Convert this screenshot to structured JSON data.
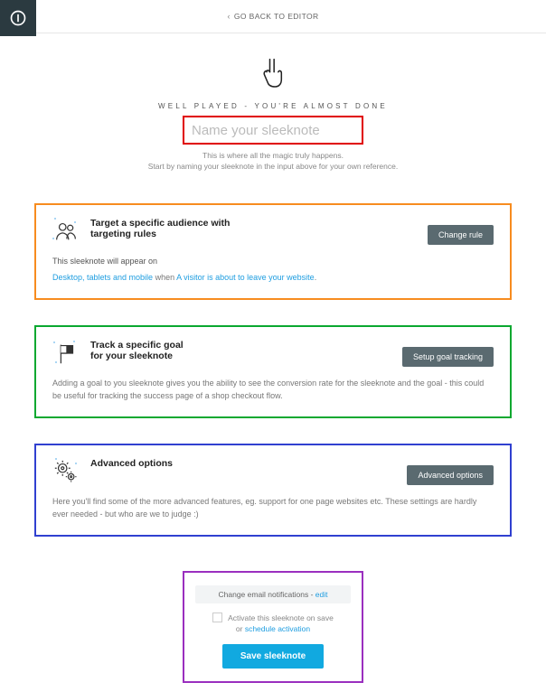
{
  "topbar": {
    "back_label": "GO BACK TO EDITOR"
  },
  "hero": {
    "title": "WELL PLAYED - YOU'RE ALMOST DONE",
    "name_placeholder": "Name your sleeknote",
    "sub1": "This is where all the magic truly happens.",
    "sub2": "Start by naming your sleeknote in the input above for your own reference."
  },
  "card_targeting": {
    "title_line1": "Target a specific audience with",
    "title_line2": "targeting rules",
    "btn": "Change rule",
    "appear_label": "This sleeknote will appear on",
    "devices": "Desktop, tablets and mobile",
    "when_word": " when ",
    "rule": "A visitor is about to leave your website",
    "period": "."
  },
  "card_goal": {
    "title_line1": "Track a specific goal",
    "title_line2": "for your sleeknote",
    "btn": "Setup goal tracking",
    "body": "Adding a goal to you sleeknote gives you the ability to see the conversion rate for the sleeknote and the goal - this could be useful for tracking the success page of a shop checkout flow."
  },
  "card_advanced": {
    "title": "Advanced options",
    "btn": "Advanced options",
    "body": "Here you'll find some of the more advanced features, eg. support for one page websites etc. These settings are hardly ever needed - but who are we to judge :)"
  },
  "footer": {
    "email_label": "Change email notifications",
    "email_sep": "  -  ",
    "email_edit": "edit",
    "activate_label": "Activate this sleeknote on save",
    "or_word": "or ",
    "schedule": "schedule activation",
    "save": "Save sleeknote"
  }
}
